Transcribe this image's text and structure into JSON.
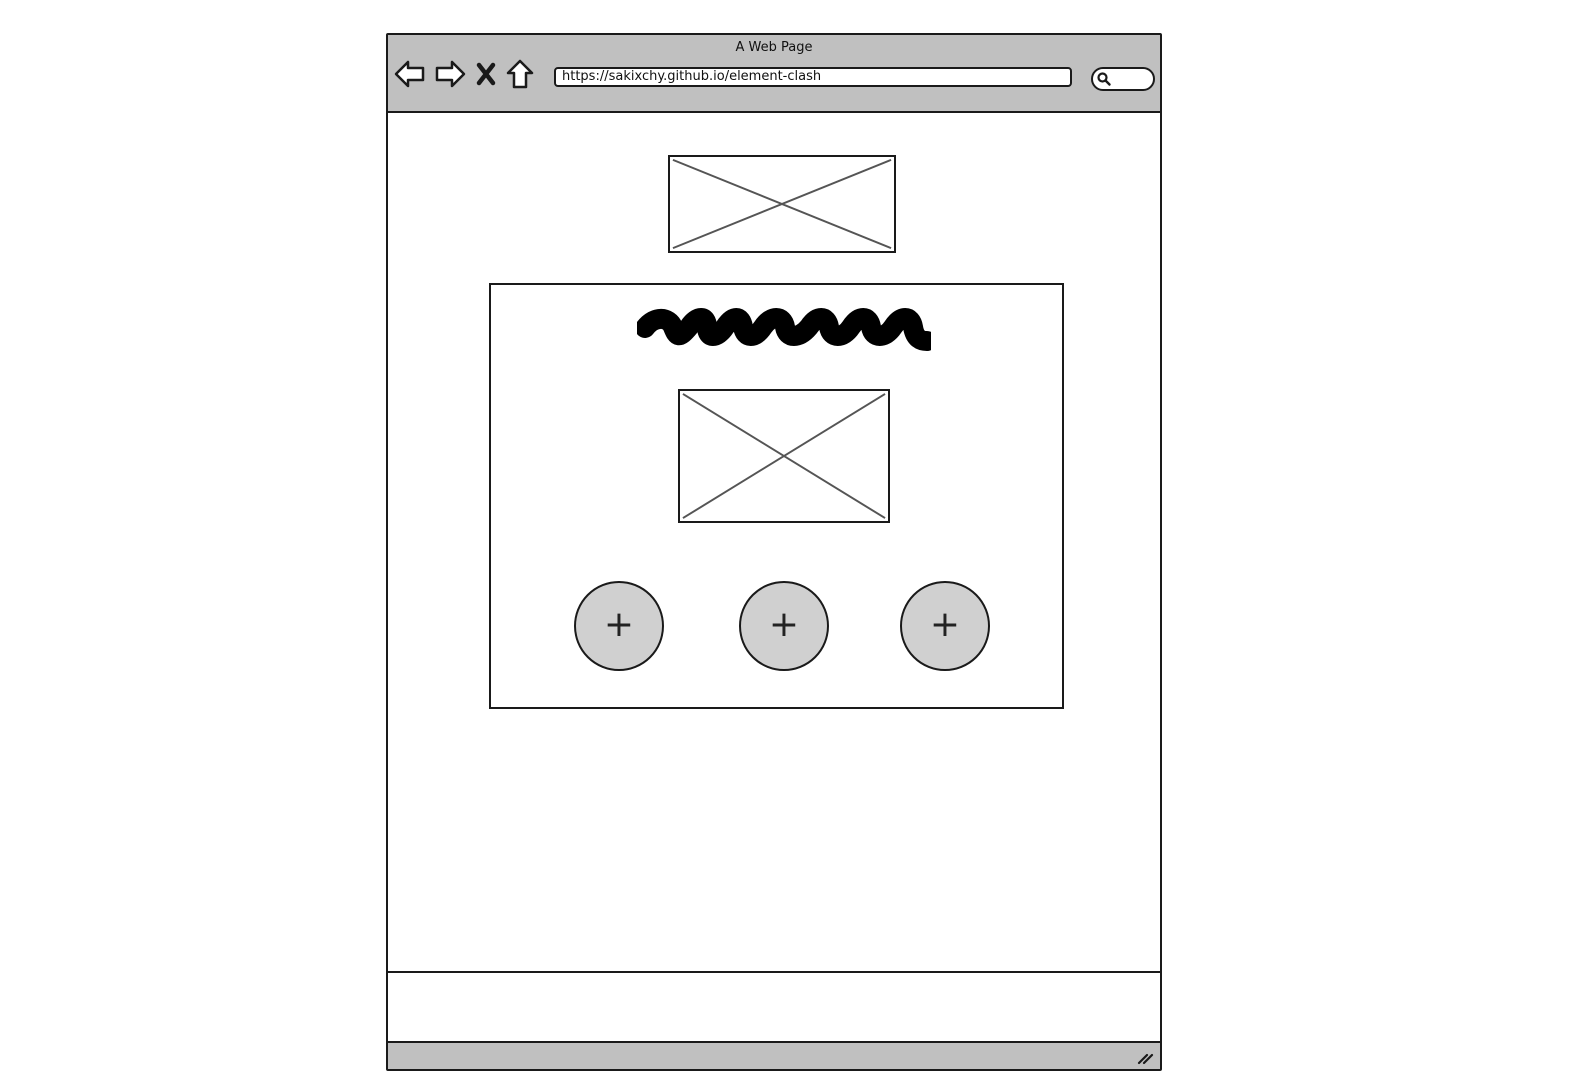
{
  "window": {
    "title": "A Web Page"
  },
  "toolbar": {
    "back_icon": "back-arrow-icon",
    "forward_icon": "forward-arrow-icon",
    "stop_icon": "close-x-icon",
    "home_icon": "home-icon"
  },
  "address_bar": {
    "url": "https://sakixchy.github.io/element-clash"
  },
  "search": {
    "icon": "search-icon"
  },
  "content": {
    "header_image_icon": "image-placeholder-icon",
    "card": {
      "heading_icon": "scribble-text-icon",
      "image_icon": "image-placeholder-icon",
      "buttons": [
        {
          "label": "+"
        },
        {
          "label": "+"
        },
        {
          "label": "+"
        }
      ]
    }
  },
  "colors": {
    "chrome_gray": "#c0c0c0",
    "button_gray": "#d0d0d0",
    "stroke": "#1a1a1a"
  }
}
